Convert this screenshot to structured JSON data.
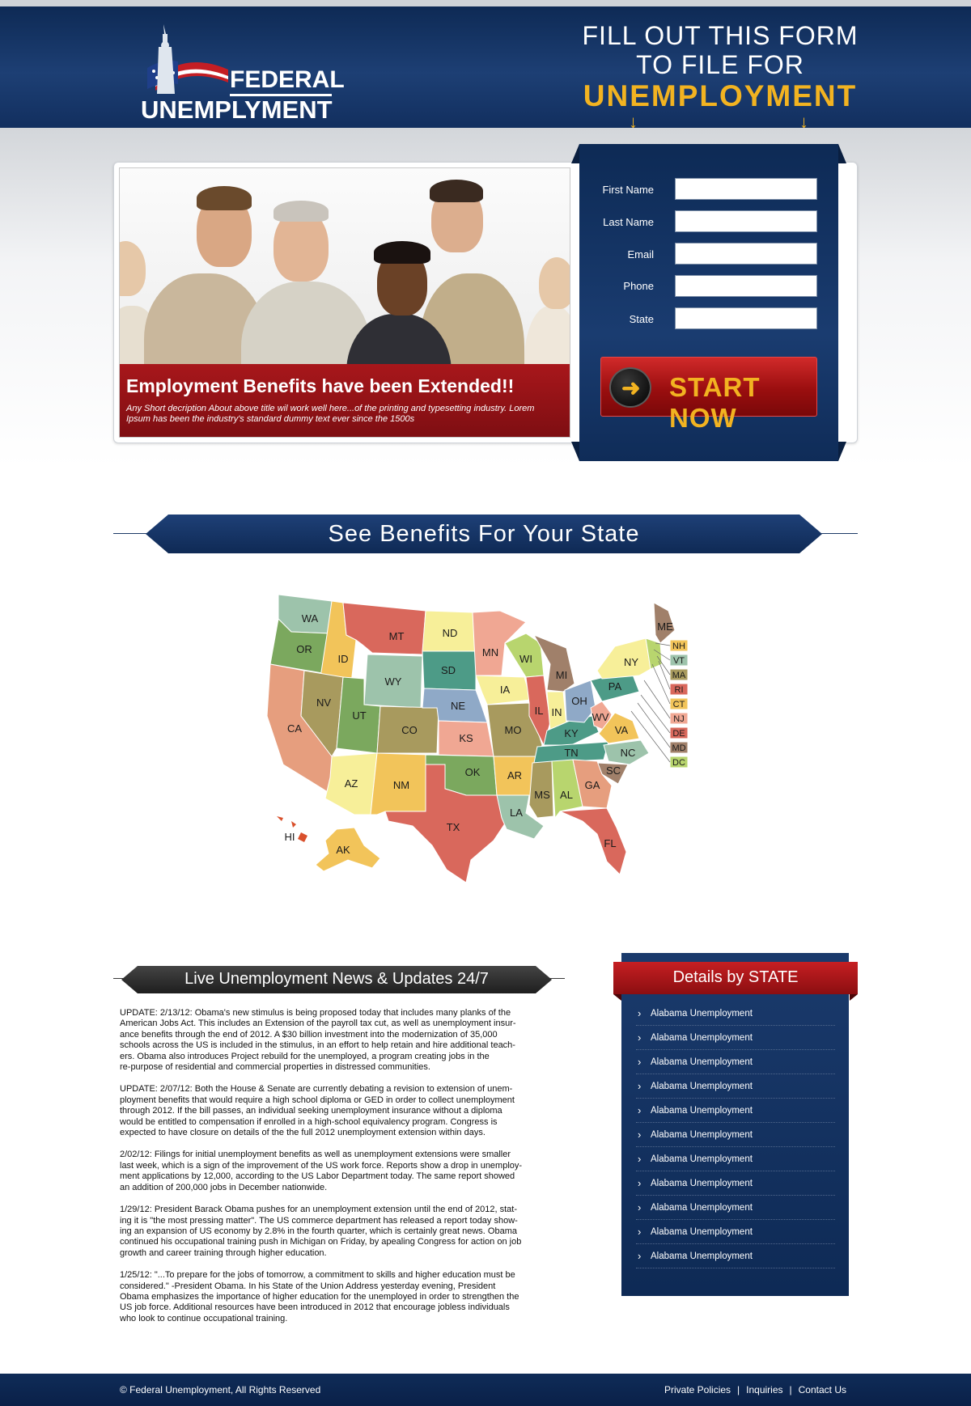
{
  "header": {
    "logo_line1": "FEDERAL",
    "logo_line2": "UNEMPLYMENT",
    "headline_line1": "FILL OUT THIS FORM",
    "headline_line2": "TO FILE FOR",
    "headline_line3": "UNEMPLOYMENT",
    "arrow_icon": "↓"
  },
  "hero": {
    "title": "Employment Benefits have been Extended!!",
    "text": "Any Short decription About above title wil work well here...of the printing and typesetting industry. Lorem Ipsum has been the industry's standard dummy text ever since the 1500s"
  },
  "form": {
    "labels": [
      "First Name",
      "Last Name",
      "Email",
      "Phone",
      "State"
    ],
    "values": [
      "",
      "",
      "",
      "",
      ""
    ],
    "button_label": "START NOW",
    "button_icon": "➜"
  },
  "benefits": {
    "title": "See Benefits For Your State",
    "states": [
      "WA",
      "OR",
      "CA",
      "ID",
      "NV",
      "MT",
      "WY",
      "UT",
      "AZ",
      "CO",
      "NM",
      "ND",
      "SD",
      "NE",
      "KS",
      "OK",
      "TX",
      "MN",
      "IA",
      "MO",
      "AR",
      "LA",
      "WI",
      "IL",
      "MI",
      "IN",
      "KY",
      "TN",
      "MS",
      "AL",
      "OH",
      "WV",
      "VA",
      "NC",
      "SC",
      "GA",
      "FL",
      "PA",
      "NY",
      "ME",
      "AK",
      "HI"
    ],
    "small_states": [
      "NH",
      "VT",
      "MA",
      "RI",
      "CT",
      "NJ",
      "DE",
      "MD",
      "DC"
    ]
  },
  "news": {
    "title": "Live Unemployment News & Updates 24/7",
    "items": [
      "UPDATE: 2/13/12: Obama's new stimulus is being proposed today that includes many planks of the\nAmerican Jobs Act. This includes an Extension of the payroll tax cut, as well as unemployment insur-\nance benefits through the end of 2012. A $30 billion investment into the modernization of 35,000\nschools across the US is included in the stimulus, in an effort to help retain and hire additional teach-\ners. Obama also introduces Project rebuild for the unemployed, a program creating jobs in the\nre-purpose of residential and commercial properties in distressed communities.",
      "UPDATE: 2/07/12: Both the House & Senate are currently debating a revision to extension of unem-\nployment benefits that would require a high school diploma or GED in order to collect unemployment\nthrough 2012. If the bill passes, an individual seeking unemployment insurance without a diploma\nwould be entitled to compensation if enrolled in a high-school equivalency program. Congress is\nexpected to have closure on details of the the full 2012 unemployment extension within days.",
      "2/02/12: Filings for initial unemployment benefits as well as unemployment extensions were smaller\nlast week, which is a sign of the improvement of the US work force. Reports show a drop in unemploy-\nment applications by 12,000, according to the US Labor Department today. The same report showed\nan addition of 200,000 jobs in December nationwide.",
      "1/29/12: President Barack Obama pushes for an unemployment extension until the end of 2012, stat-\ning it is \"the most pressing matter\". The US commerce department has released a report today show-\ning an expansion of US economy by 2.8% in the fourth quarter, which is certainly great news. Obama\ncontinued his occupational training push in Michigan on Friday, by apealing Congress for action on job\ngrowth and career training through higher education.",
      "1/25/12: \"...To prepare for the jobs of tomorrow, a commitment to skills and higher education must be\nconsidered.\" -President Obama. In his State of the Union Address yesterday evening, President\nObama emphasizes the importance of higher education for the unemployed in order to strengthen the\nUS job force. Additional resources have been introduced in 2012 that encourage jobless individuals\nwho look to continue occupational training."
    ]
  },
  "details": {
    "title": "Details by STATE",
    "chevron": "›",
    "items": [
      "Alabama Unemployment",
      "Alabama Unemployment",
      "Alabama Unemployment",
      "Alabama Unemployment",
      "Alabama Unemployment",
      "Alabama Unemployment",
      "Alabama Unemployment",
      "Alabama Unemployment",
      "Alabama Unemployment",
      "Alabama Unemployment",
      "Alabama Unemployment"
    ]
  },
  "footer": {
    "copyright": "© Federal Unemployment, All Rights Reserved",
    "links": [
      "Private Policies",
      "Inquiries",
      "Contact Us"
    ],
    "separator": "|"
  },
  "colors": {
    "navy": "#0e2a55",
    "red": "#a8171b",
    "gold": "#f2b321"
  }
}
